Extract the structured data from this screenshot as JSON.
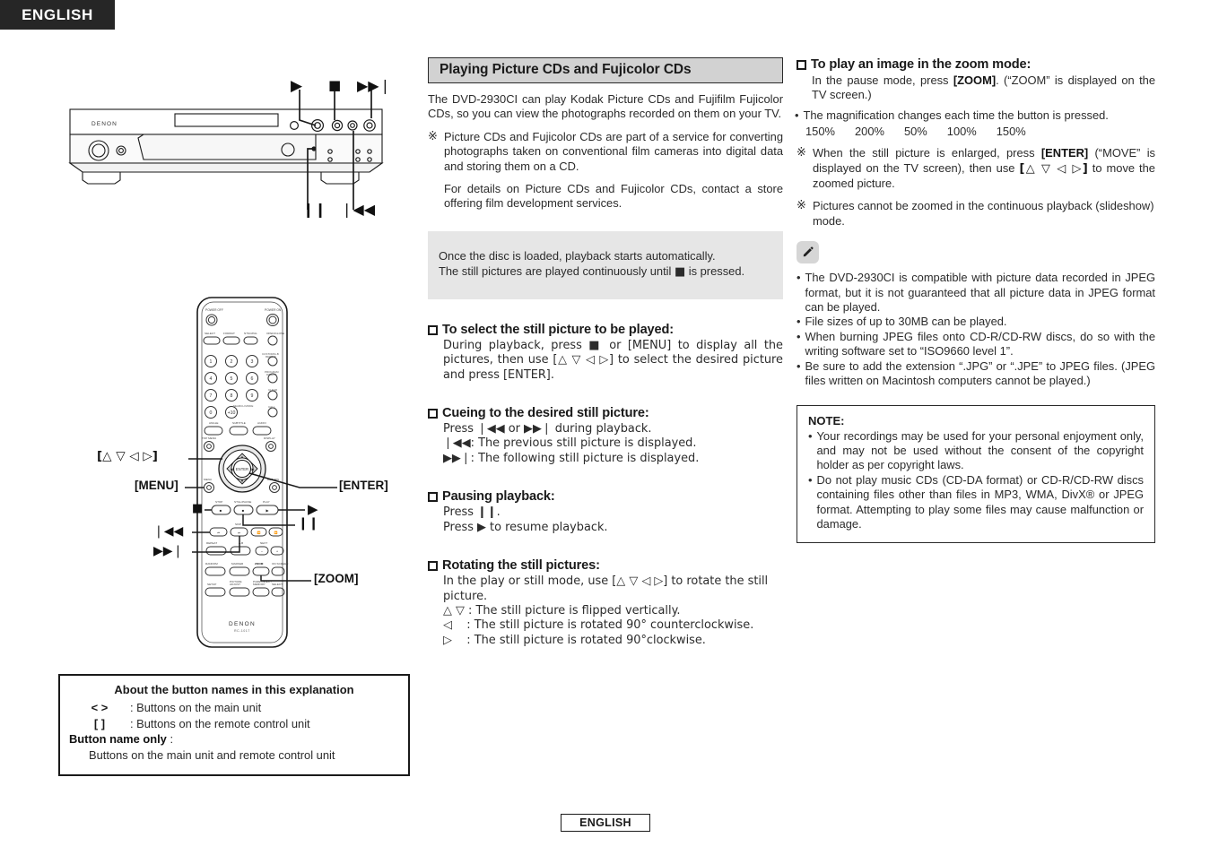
{
  "header": {
    "language_tab": "ENGLISH"
  },
  "footer": {
    "language": "ENGLISH"
  },
  "figures": {
    "front_panel": {
      "brand": "DENON",
      "callouts": [
        {
          "name": "play",
          "glyph": "▶"
        },
        {
          "name": "stop",
          "glyph": "■"
        },
        {
          "name": "next-skip",
          "glyph": "▶▶❘"
        },
        {
          "name": "pause",
          "glyph": "❙❙"
        },
        {
          "name": "prev-skip",
          "glyph": "❘◀◀"
        }
      ]
    },
    "remote": {
      "brand": "DENON",
      "model": "RC-1017",
      "callouts": [
        {
          "name": "cursor-keys",
          "label": "[△ ▽ ◁ ▷]"
        },
        {
          "name": "menu",
          "label": "[MENU]"
        },
        {
          "name": "enter",
          "label": "[ENTER]"
        },
        {
          "name": "stop",
          "label": "■"
        },
        {
          "name": "play",
          "label": "▶"
        },
        {
          "name": "pause",
          "label": "❙❙"
        },
        {
          "name": "prev-skip",
          "label": "❘◀◀"
        },
        {
          "name": "next-skip",
          "label": "▶▶❘"
        },
        {
          "name": "zoom",
          "label": "[ZOOM]"
        }
      ]
    }
  },
  "legend": {
    "title": "About the button names in this explanation",
    "rows": [
      {
        "key": "<    >",
        "value": ": Buttons on the main unit"
      },
      {
        "key": "[     ]",
        "value": ": Buttons on the remote control unit"
      }
    ],
    "bold_label": "Button name only",
    "bold_label_suffix": ":",
    "last_line": "Buttons on the main unit and remote control unit"
  },
  "main": {
    "section_title": "Playing Picture CDs and Fujicolor CDs",
    "intro": "The DVD-2930CI can play Kodak Picture CDs and Fujifilm Fujicolor CDs, so you can view the photographs recorded on them on your TV.",
    "note_mark": "※",
    "note_1": "Picture CDs and Fujicolor CDs are part of a service for converting photographs taken on conventional film cameras into digital data and storing them on a CD.",
    "note_2": "For details on Picture CDs and Fujicolor CDs, contact a store offering film development services.",
    "gray_box": {
      "line1": "Once the disc is loaded, playback starts automatically.",
      "line2_pre": "The still pictures are played continuously until ",
      "line2_glyph": "■",
      "line2_post": " is pressed."
    },
    "blocks": [
      {
        "title": "To select the still picture to be played:",
        "lines": [
          "During playback, press ■ or [MENU] to display all the pictures, then use [△ ▽ ◁ ▷] to select the desired picture and press [ENTER]."
        ]
      },
      {
        "title": "Cueing to the desired still picture:",
        "lines": [
          "Press ❘◀◀ or ▶▶❘ during playback.",
          "❘◀◀: The previous still picture is displayed.",
          "▶▶❘: The following still picture is displayed."
        ]
      },
      {
        "title": "Pausing playback:",
        "lines": [
          "Press ❙❙.",
          "Press ▶ to resume playback."
        ]
      },
      {
        "title": "Rotating the still pictures:",
        "lines": [
          "In the play or still mode, use [△ ▽ ◁ ▷] to rotate the still picture.",
          "△ ▽ : The still picture is flipped vertically.",
          "◁    : The still picture is rotated 90° counterclockwise.",
          "▷    : The still picture is rotated 90°clockwise."
        ]
      }
    ]
  },
  "right": {
    "zoom_block": {
      "title": "To play an image in the zoom mode:",
      "line1_a": "In the pause mode, press ",
      "line1_b": "[ZOOM]",
      "line1_c": ". (“ZOOM” is displayed on the TV screen.)",
      "bullet_dot": "•",
      "bullet_1": "The magnification changes each time the button is pressed.",
      "magnifications": [
        "150%",
        "200%",
        "50%",
        "100%",
        "150%"
      ],
      "note_mark": "※",
      "note_1_a": "When the still picture is enlarged, press ",
      "note_1_b": "[ENTER]",
      "note_1_c": " (“MOVE” is displayed on the TV screen), then use ",
      "note_1_d": "[△ ▽ ◁ ▷]",
      "note_1_e": " to move the zoomed picture.",
      "note_2": "Pictures cannot be zoomed in the continuous playback (slideshow) mode."
    },
    "pencil_note": {
      "icon": "pencil-icon",
      "bullets": [
        "The DVD-2930CI is compatible with picture data recorded in JPEG format, but it is not guaranteed that all picture data in JPEG format can be played.",
        "File sizes of up to 30MB can be played.",
        "When burning JPEG files onto CD-R/CD-RW discs, do so with the writing software set to “ISO9660 level 1”.",
        "Be sure to add the extension “.JPG” or “.JPE” to JPEG files. (JPEG files written on Macintosh computers cannot be played.)"
      ]
    },
    "note_box": {
      "title": "NOTE:",
      "bullets": [
        "Your recordings may be used for your personal enjoyment only, and may not be used without the consent of the copyright holder as per copyright laws.",
        "Do not play music CDs (CD-DA format) or CD-R/CD-RW discs containing files other than files in MP3, WMA, DivX® or JPEG format. Attempting to play some files may cause malfunction or damage."
      ]
    }
  }
}
